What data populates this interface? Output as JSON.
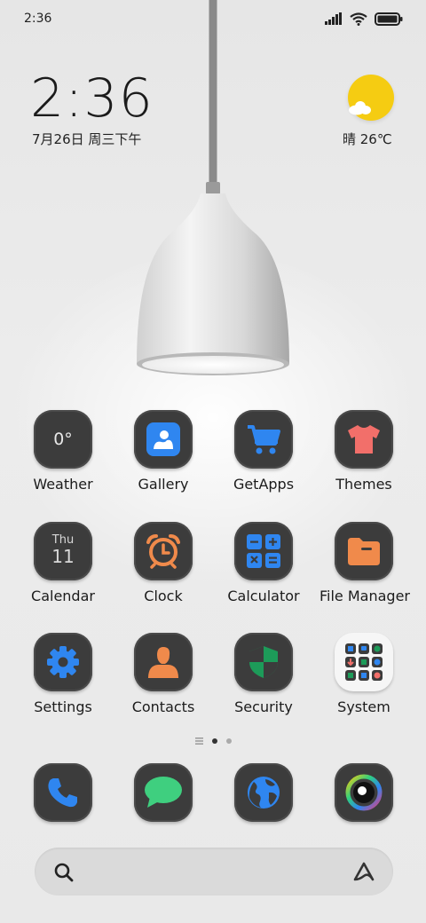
{
  "status_bar": {
    "time": "2:36"
  },
  "clock_widget": {
    "time": "2:36",
    "date": "7月26日 周三下午"
  },
  "weather_widget": {
    "condition_temp": "晴 26℃"
  },
  "apps": [
    {
      "label": "Weather",
      "icon": "weather-icon",
      "icon_text": "0°"
    },
    {
      "label": "Gallery",
      "icon": "gallery-icon"
    },
    {
      "label": "GetApps",
      "icon": "shopping-cart-icon"
    },
    {
      "label": "Themes",
      "icon": "t-shirt-icon"
    },
    {
      "label": "Calendar",
      "icon": "calendar-icon",
      "icon_day": "Thu",
      "icon_date": "11"
    },
    {
      "label": "Clock",
      "icon": "alarm-clock-icon"
    },
    {
      "label": "Calculator",
      "icon": "calculator-icon"
    },
    {
      "label": "File Manager",
      "icon": "folder-icon"
    },
    {
      "label": "Settings",
      "icon": "gear-icon"
    },
    {
      "label": "Contacts",
      "icon": "person-icon"
    },
    {
      "label": "Security",
      "icon": "shield-icon"
    },
    {
      "label": "System",
      "icon": "folder-grid-icon"
    }
  ],
  "page_indicator": {
    "pages": 2,
    "current": 1
  },
  "dock": [
    {
      "name": "phone",
      "icon": "phone-icon"
    },
    {
      "name": "messages",
      "icon": "message-bubble-icon"
    },
    {
      "name": "browser",
      "icon": "globe-icon"
    },
    {
      "name": "camera",
      "icon": "camera-lens-icon"
    }
  ],
  "search_bar": {
    "icon": "search-icon",
    "assistant_icon": "assistant-icon"
  },
  "colors": {
    "blue": "#2f86f0",
    "orange": "#f08a4b",
    "coral": "#f26f6a",
    "green": "#1d9b59",
    "yellow": "#f5cc12",
    "icon_bg": "#3c3c3c"
  }
}
